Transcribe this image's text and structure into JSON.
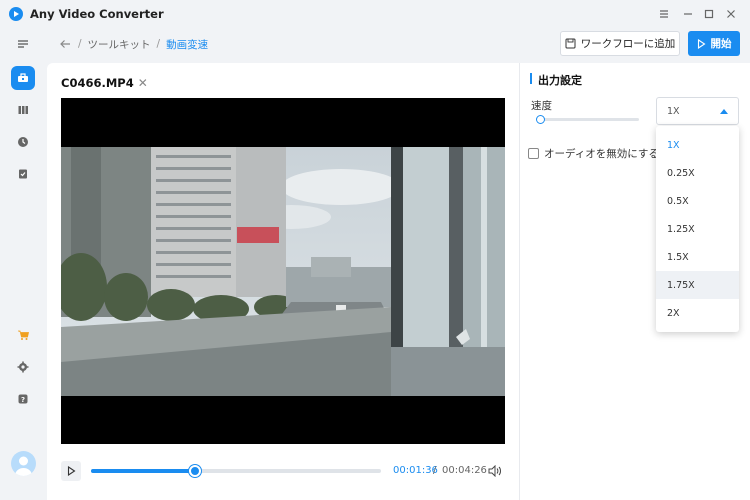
{
  "app": {
    "title": "Any Video Converter",
    "accent_color": "#1a8cf0"
  },
  "window_controls": [
    "menu-icon",
    "minimize-icon",
    "maximize-icon",
    "close-icon"
  ],
  "sidebar": {
    "items": [
      {
        "name": "menu-toggle",
        "icon": "menu-lines-icon"
      },
      {
        "name": "toolkit",
        "icon": "toolbox-icon",
        "active": true
      },
      {
        "name": "library",
        "icon": "books-icon"
      },
      {
        "name": "history",
        "icon": "clock-icon"
      },
      {
        "name": "tasks",
        "icon": "checklist-icon"
      },
      {
        "name": "store",
        "icon": "cart-icon"
      },
      {
        "name": "settings",
        "icon": "gear-icon"
      },
      {
        "name": "help",
        "icon": "help-icon"
      }
    ],
    "avatar_icon": "user-avatar-icon"
  },
  "breadcrumb": {
    "items": [
      "ツールキット",
      "動画変速"
    ]
  },
  "header": {
    "workflow_label": "ワークフローに追加",
    "start_label": "開始"
  },
  "file": {
    "name": "C0466.MP4"
  },
  "player": {
    "current_time": "00:01:36",
    "separator": "/",
    "total_time": "00:04:26",
    "progress": 0.36
  },
  "output": {
    "section_title": "出力設定",
    "speed_label": "速度",
    "speed_value": "1X",
    "speed_slider_position": 0,
    "mute_audio_label": "オーディオを無効にする",
    "mute_audio_checked": false,
    "speed_options": [
      "1X",
      "0.25X",
      "0.5X",
      "1.25X",
      "1.5X",
      "1.75X",
      "2X"
    ],
    "speed_selected_index": 0,
    "speed_hover_index": 5
  }
}
